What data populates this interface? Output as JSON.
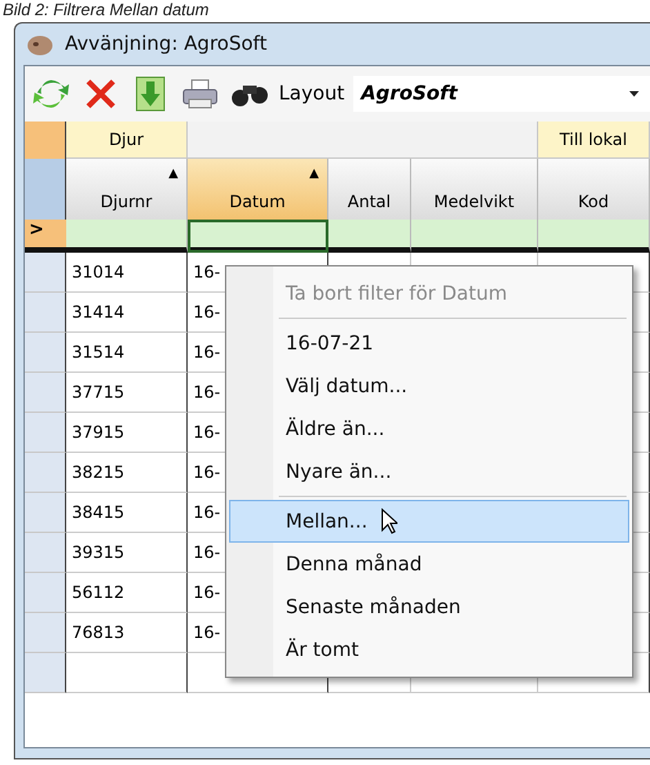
{
  "caption": "Bild 2: Filtrera Mellan datum",
  "window": {
    "title": "Avvänjning: AgroSoft"
  },
  "toolbar": {
    "layout_label": "Layout",
    "layout_value": "AgroSoft"
  },
  "table": {
    "groups": [
      {
        "label": "Djur"
      },
      {
        "label": "Till lokal"
      }
    ],
    "columns": [
      {
        "label": "Djurnr",
        "sort_mark": "▲"
      },
      {
        "label": "Datum",
        "sort_mark": "▲"
      },
      {
        "label": "Antal"
      },
      {
        "label": "Medelvikt"
      },
      {
        "label": "Kod"
      }
    ],
    "filter_marker": ">",
    "rows": [
      {
        "djurnr": "31014",
        "datum": "16-"
      },
      {
        "djurnr": "31414",
        "datum": "16-"
      },
      {
        "djurnr": "31514",
        "datum": "16-"
      },
      {
        "djurnr": "37715",
        "datum": "16-"
      },
      {
        "djurnr": "37915",
        "datum": "16-"
      },
      {
        "djurnr": "38215",
        "datum": "16-"
      },
      {
        "djurnr": "38415",
        "datum": "16-"
      },
      {
        "djurnr": "39315",
        "datum": "16-"
      },
      {
        "djurnr": "56112",
        "datum": "16-"
      },
      {
        "djurnr": "76813",
        "datum": "16-"
      }
    ]
  },
  "context_menu": {
    "items": [
      {
        "label": "Ta bort filter för Datum",
        "disabled": true,
        "selected": false,
        "separator_after": true
      },
      {
        "label": "16-07-21",
        "disabled": false,
        "selected": false,
        "separator_after": false
      },
      {
        "label": "Välj datum...",
        "disabled": false,
        "selected": false,
        "separator_after": false
      },
      {
        "label": "Äldre än...",
        "disabled": false,
        "selected": false,
        "separator_after": false
      },
      {
        "label": "Nyare än...",
        "disabled": false,
        "selected": false,
        "separator_after": true
      },
      {
        "label": "Mellan...",
        "disabled": false,
        "selected": true,
        "separator_after": false
      },
      {
        "label": "Denna månad",
        "disabled": false,
        "selected": false,
        "separator_after": false
      },
      {
        "label": "Senaste månaden",
        "disabled": false,
        "selected": false,
        "separator_after": false
      },
      {
        "label": "Är tomt",
        "disabled": false,
        "selected": false,
        "separator_after": false
      }
    ]
  }
}
